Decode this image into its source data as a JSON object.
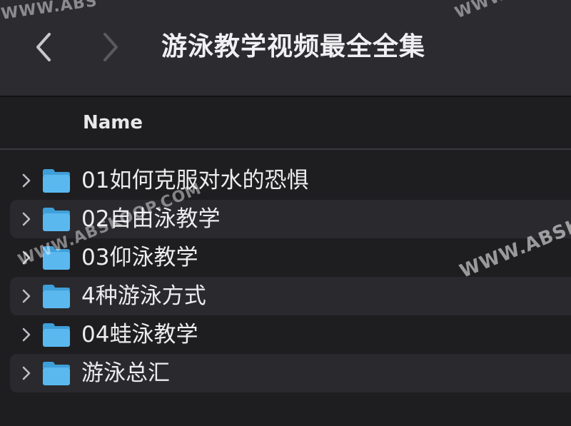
{
  "window": {
    "title": "游泳教学视频最全全集"
  },
  "nav": {
    "back_icon": "chevron-left-icon",
    "forward_icon": "chevron-right-icon"
  },
  "columns": {
    "name": "Name"
  },
  "items": [
    {
      "label": "01如何克服对水的恐惧",
      "icon": "folder-icon"
    },
    {
      "label": "02自由泳教学",
      "icon": "folder-icon"
    },
    {
      "label": "03仰泳教学",
      "icon": "folder-icon"
    },
    {
      "label": "4种游泳方式",
      "icon": "folder-icon"
    },
    {
      "label": "04蛙泳教学",
      "icon": "folder-icon"
    },
    {
      "label": "游泳总汇",
      "icon": "folder-icon"
    }
  ],
  "watermark": {
    "text_top_left": "WWW.ABS",
    "text_top_right": "WWW.ABS",
    "text_middle_left": "WWW.ABSKOOP.COM",
    "text_middle_right": "WWW.ABSKO"
  },
  "colors": {
    "toolbar_bg": "#2c2b2f",
    "window_bg": "#1e1e21",
    "row_alt_bg": "#2a2a2e",
    "folder_blue": "#5ab8ef"
  }
}
